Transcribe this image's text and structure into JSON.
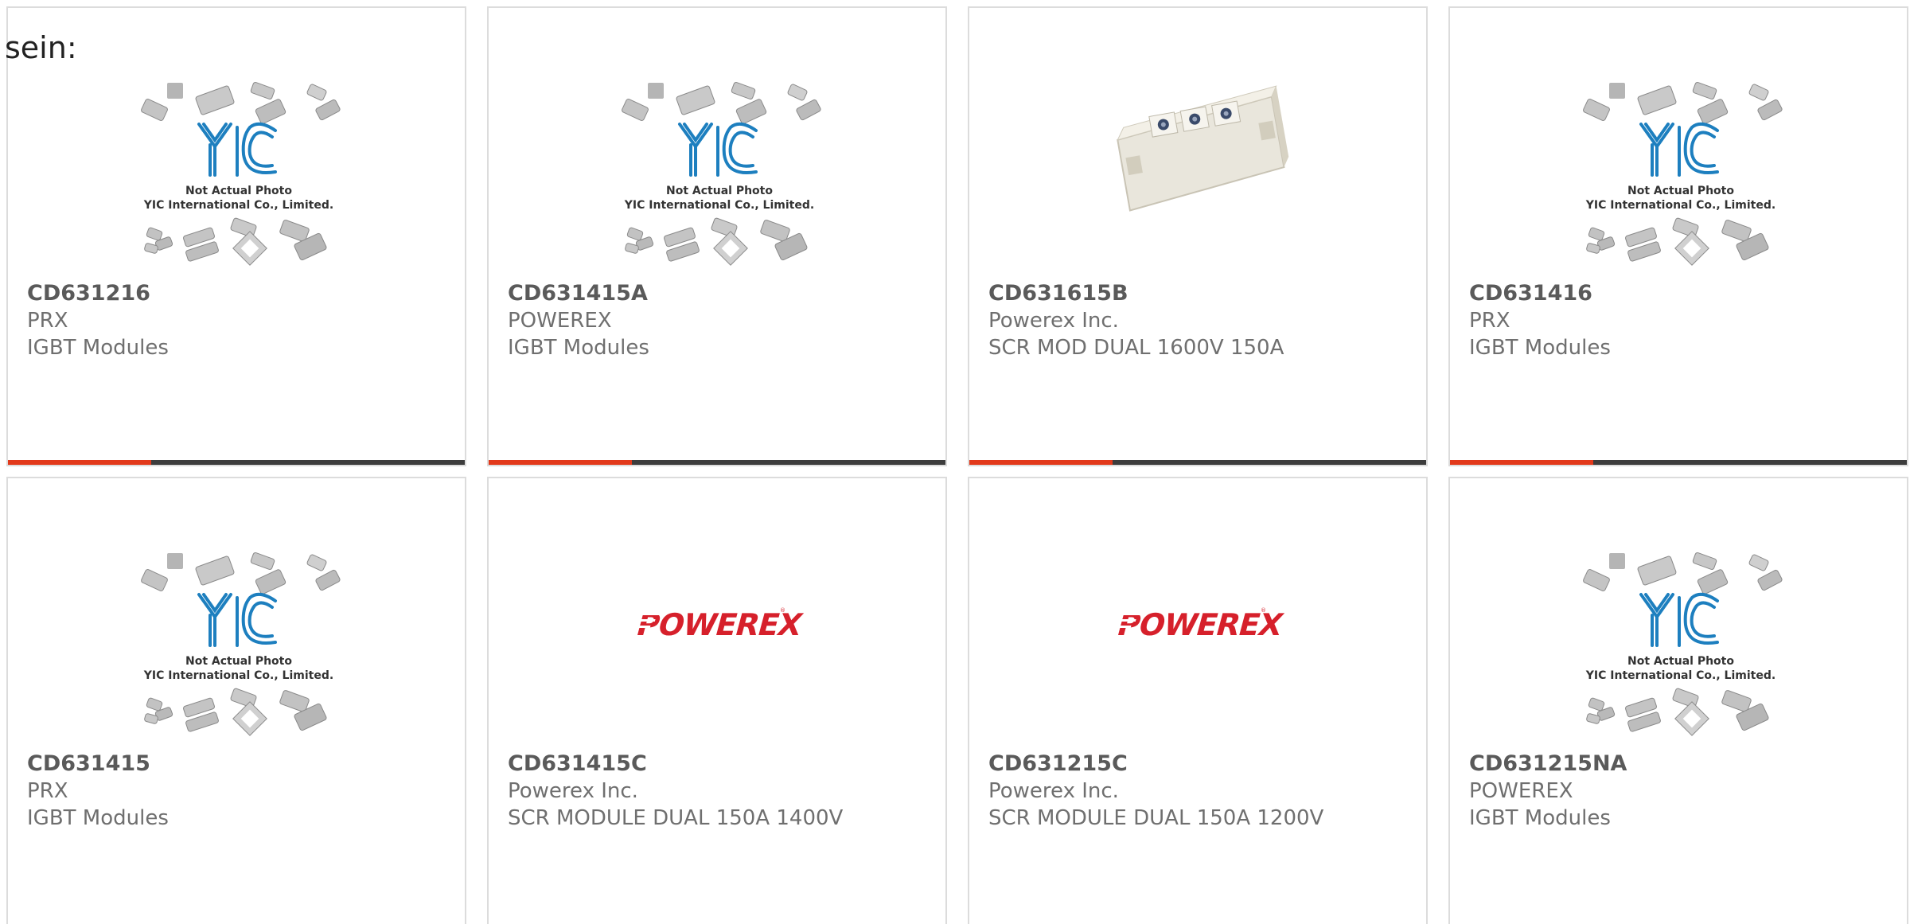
{
  "overlay_label": "sein:",
  "colors": {
    "accent": "#e2391b",
    "bar": "#3d3d3d",
    "border": "#dcdcdc",
    "yic_blue": "#1d7fbf",
    "powerex_red": "#d6202b"
  },
  "products": [
    {
      "part": "CD631216",
      "maker": "PRX",
      "desc": "IGBT Modules",
      "image": "yic-placeholder",
      "img_caption_1": "Not Actual Photo",
      "img_caption_2": "YIC International Co., Limited."
    },
    {
      "part": "CD631415A",
      "maker": "POWEREX",
      "desc": "IGBT Modules",
      "image": "yic-placeholder",
      "img_caption_1": "Not Actual Photo",
      "img_caption_2": "YIC International Co., Limited."
    },
    {
      "part": "CD631615B",
      "maker": "Powerex Inc.",
      "desc": "SCR MOD DUAL 1600V 150A",
      "image": "module-photo"
    },
    {
      "part": "CD631416",
      "maker": "PRX",
      "desc": "IGBT Modules",
      "image": "yic-placeholder",
      "img_caption_1": "Not Actual Photo",
      "img_caption_2": "YIC International Co., Limited."
    },
    {
      "part": "CD631415",
      "maker": "PRX",
      "desc": "IGBT Modules",
      "image": "yic-placeholder",
      "img_caption_1": "Not Actual Photo",
      "img_caption_2": "YIC International Co., Limited."
    },
    {
      "part": "CD631415C",
      "maker": "Powerex Inc.",
      "desc": "SCR MODULE DUAL 150A 1400V",
      "image": "powerex-logo"
    },
    {
      "part": "CD631215C",
      "maker": "Powerex Inc.",
      "desc": "SCR MODULE DUAL 150A 1200V",
      "image": "powerex-logo"
    },
    {
      "part": "CD631215NA",
      "maker": "POWEREX",
      "desc": "IGBT Modules",
      "image": "yic-placeholder",
      "img_caption_1": "Not Actual Photo",
      "img_caption_2": "YIC International Co., Limited."
    }
  ]
}
